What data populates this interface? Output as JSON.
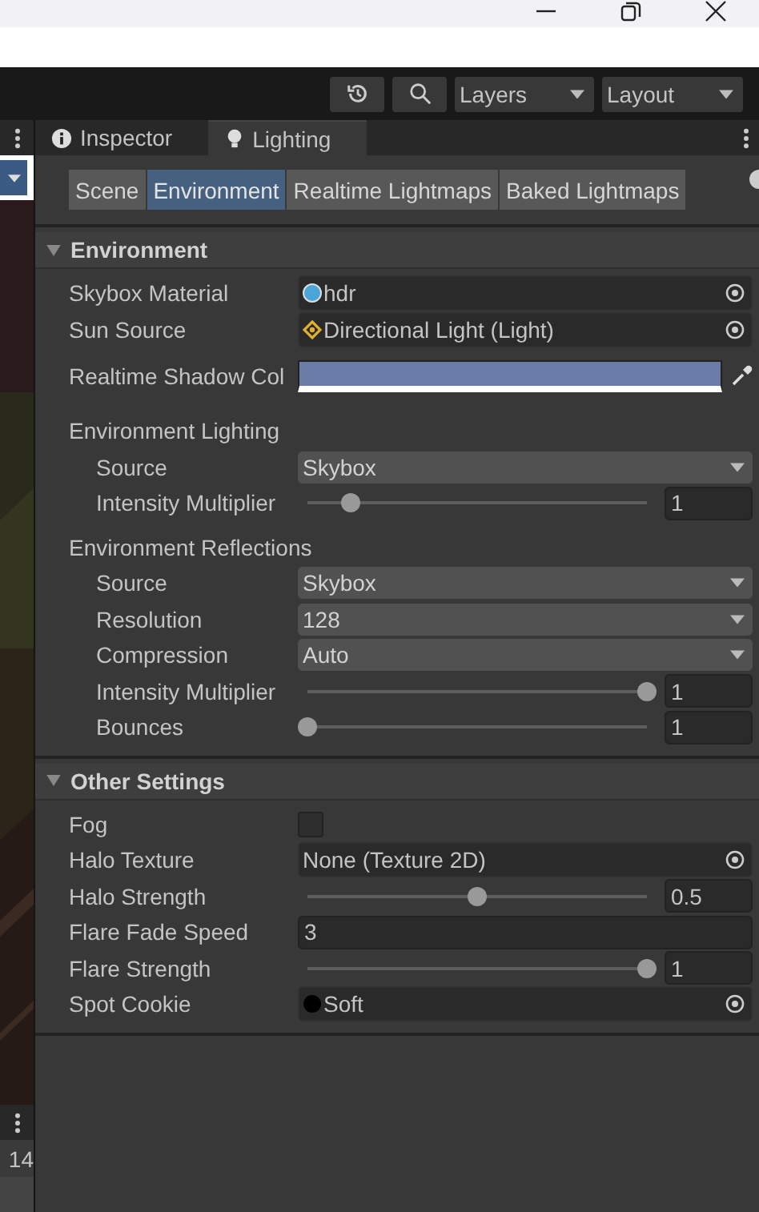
{
  "toolbar": {
    "dropdowns": [
      "Layers",
      "Layout"
    ]
  },
  "left_strip": {
    "number": "14"
  },
  "tabs": [
    {
      "label": "Inspector",
      "selected": false
    },
    {
      "label": "Lighting",
      "selected": true
    }
  ],
  "subtabs": [
    {
      "label": "Scene",
      "selected": false
    },
    {
      "label": "Environment",
      "selected": true
    },
    {
      "label": "Realtime Lightmaps",
      "selected": false
    },
    {
      "label": "Baked Lightmaps",
      "selected": false
    }
  ],
  "sections": [
    {
      "title": "Environment",
      "expanded": true,
      "rows": [
        {
          "kind": "object",
          "label": "Skybox Material",
          "value": "hdr"
        },
        {
          "kind": "object",
          "label": "Sun Source",
          "value": "Directional Light (Light)"
        },
        {
          "kind": "color",
          "label": "Realtime Shadow Col",
          "color": "#6b7ca8"
        },
        {
          "kind": "group",
          "label": "Environment Lighting",
          "children": [
            {
              "kind": "dropdown",
              "label": "Source",
              "value": "Skybox"
            },
            {
              "kind": "slider",
              "label": "Intensity Multiplier",
              "level": 0.125,
              "value": "1"
            }
          ]
        },
        {
          "kind": "group",
          "label": "Environment Reflections",
          "children": [
            {
              "kind": "dropdown",
              "label": "Source",
              "value": "Skybox"
            },
            {
              "kind": "dropdown",
              "label": "Resolution",
              "value": "128"
            },
            {
              "kind": "dropdown",
              "label": "Compression",
              "value": "Auto"
            },
            {
              "kind": "slider",
              "label": "Intensity Multiplier",
              "level": 1,
              "value": "1"
            },
            {
              "kind": "slider",
              "label": "Bounces",
              "level": 0,
              "value": "1"
            }
          ]
        }
      ]
    },
    {
      "title": "Other Settings",
      "expanded": true,
      "rows": [
        {
          "kind": "checkbox",
          "label": "Fog",
          "checked": false
        },
        {
          "kind": "object",
          "label": "Halo Texture",
          "value": "None (Texture 2D)"
        },
        {
          "kind": "slider",
          "label": "Halo Strength",
          "level": 0.5,
          "value": "0.5"
        },
        {
          "kind": "text",
          "label": "Flare Fade Speed",
          "value": "3"
        },
        {
          "kind": "slider",
          "label": "Flare Strength",
          "level": 1,
          "value": "1"
        },
        {
          "kind": "object",
          "label": "Spot Cookie",
          "value": "Soft"
        }
      ]
    }
  ]
}
